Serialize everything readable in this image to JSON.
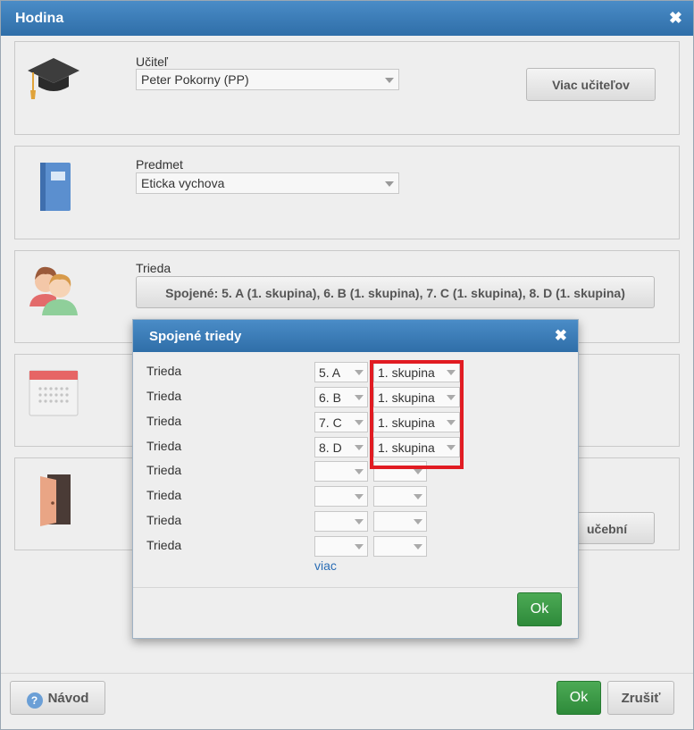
{
  "dialog": {
    "title": "Hodina",
    "close_glyph": "✖"
  },
  "teacher": {
    "label": "Učiteľ",
    "value": "Peter Pokorny (PP)",
    "more_button": "Viac učiteľov",
    "icon": "graduation-cap-icon"
  },
  "subject": {
    "label": "Predmet",
    "value": "Eticka vychova",
    "icon": "book-icon"
  },
  "class": {
    "label": "Trieda",
    "joined_button": "Spojené: 5. A (1. skupina), 6. B (1. skupina), 7. C (1. skupina), 8. D (1. skupina)",
    "icon": "people-icon"
  },
  "calendar": {
    "icon": "calendar-icon"
  },
  "room": {
    "icon": "door-icon",
    "button_partial": "učební"
  },
  "footer": {
    "help_button": "Návod",
    "ok_button": "Ok",
    "cancel_button": "Zrušiť"
  },
  "modal": {
    "title": "Spojené triedy",
    "close_glyph": "✖",
    "rows": [
      {
        "label": "Trieda",
        "class": "5. A",
        "group": "1. skupina"
      },
      {
        "label": "Trieda",
        "class": "6. B",
        "group": "1. skupina"
      },
      {
        "label": "Trieda",
        "class": "7. C",
        "group": "1. skupina"
      },
      {
        "label": "Trieda",
        "class": "8. D",
        "group": "1. skupina"
      },
      {
        "label": "Trieda",
        "class": "",
        "group": ""
      },
      {
        "label": "Trieda",
        "class": "",
        "group": ""
      },
      {
        "label": "Trieda",
        "class": "",
        "group": ""
      },
      {
        "label": "Trieda",
        "class": "",
        "group": ""
      }
    ],
    "more_link": "viac",
    "ok_button": "Ok"
  },
  "colors": {
    "titlebar": "#2f6ea8",
    "ok_green": "#2e8a3a",
    "highlight": "#e11b22",
    "link": "#2a6db5"
  }
}
